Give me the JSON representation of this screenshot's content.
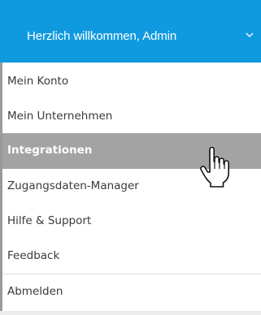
{
  "header": {
    "title": "Herzlich willkommen, Admin",
    "chevron_icon": "chevron-down-icon",
    "background_color": "#0f9adf",
    "text_color": "#ffffff"
  },
  "menu": {
    "items": [
      {
        "label": "Mein Konto",
        "active": false
      },
      {
        "label": "Mein Unternehmen",
        "active": false
      },
      {
        "label": "Integrationen",
        "active": true
      },
      {
        "label": "Zugangsdaten-Manager",
        "active": false
      },
      {
        "label": "Hilfe & Support",
        "active": false
      },
      {
        "label": "Feedback",
        "active": false
      },
      {
        "label": "Abmelden",
        "active": false
      }
    ],
    "active_background_color": "#a3a3a3",
    "text_color": "#3a3a3a"
  },
  "cursor": {
    "icon": "hand-pointer-icon"
  }
}
